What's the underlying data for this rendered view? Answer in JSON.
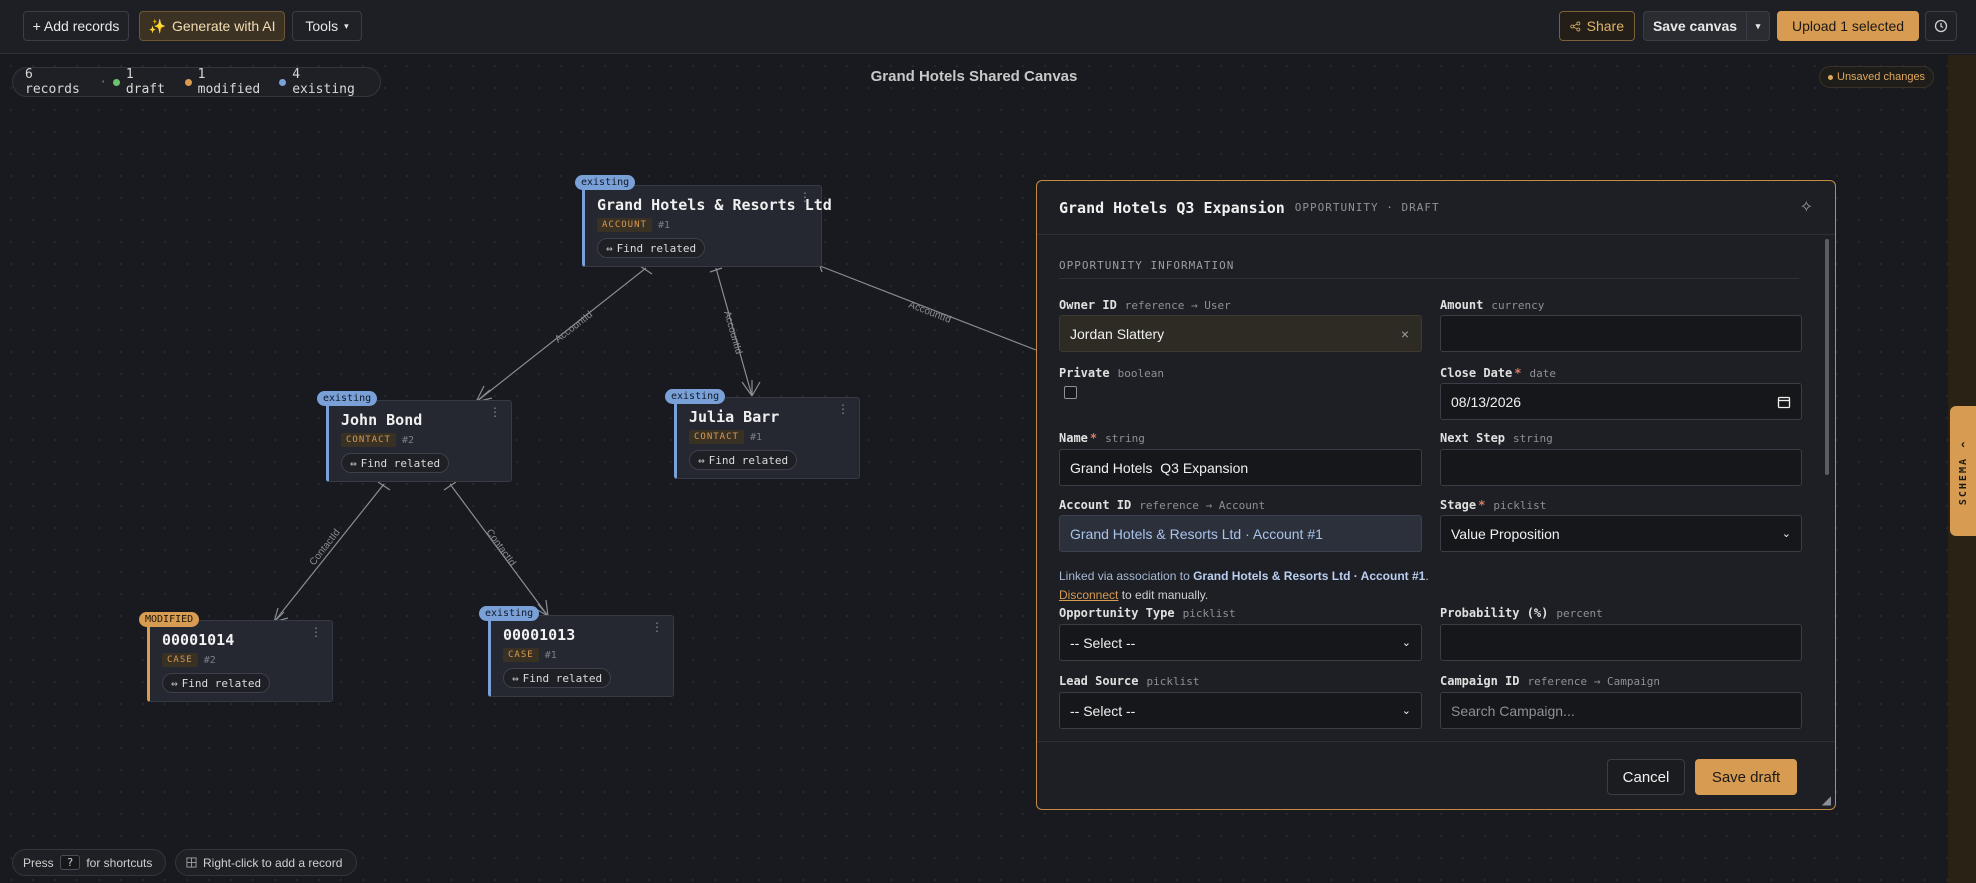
{
  "toolbar": {
    "add_records": "+ Add records",
    "generate_ai": "Generate with AI",
    "tools": "Tools",
    "share": "Share",
    "save_canvas": "Save canvas",
    "upload": "Upload 1 selected"
  },
  "status": {
    "records": "6 records",
    "draft": "1 draft",
    "modified": "1 modified",
    "existing": "4 existing",
    "colors": {
      "draft": "#6cc26c",
      "modified": "#d79b51",
      "existing": "#7aa0d8"
    }
  },
  "canvas_title": "Grand Hotels Shared Canvas",
  "unsaved": "Unsaved changes",
  "cards": {
    "account": {
      "badge": "existing",
      "title": "Grand Hotels & Resorts Ltd",
      "type": "ACCOUNT",
      "num": "#1",
      "find": "Find related"
    },
    "john": {
      "badge": "existing",
      "title": "John Bond",
      "type": "CONTACT",
      "num": "#2",
      "find": "Find related"
    },
    "julia": {
      "badge": "existing",
      "title": "Julia Barr",
      "type": "CONTACT",
      "num": "#1",
      "find": "Find related"
    },
    "case1014": {
      "badge": "MODIFIED",
      "title": "00001014",
      "type": "CASE",
      "num": "#2",
      "find": "Find related"
    },
    "case1013": {
      "badge": "existing",
      "title": "00001013",
      "type": "CASE",
      "num": "#1",
      "find": "Find related"
    }
  },
  "edges": {
    "account_john": "AccountId",
    "account_julia": "AccountId",
    "account_modal": "AccountId",
    "john_1014": "ContactId",
    "john_1013": "ContactId"
  },
  "modal": {
    "title": "Grand Hotels Q3 Expansion",
    "subtitle": "OPPORTUNITY · DRAFT",
    "section": "OPPORTUNITY INFORMATION",
    "owner": {
      "label": "Owner ID",
      "type": "reference → User",
      "value": "Jordan Slattery"
    },
    "amount": {
      "label": "Amount",
      "type": "currency",
      "value": ""
    },
    "private": {
      "label": "Private",
      "type": "boolean"
    },
    "close_date": {
      "label": "Close Date",
      "type": "date",
      "value": "08/13/2026"
    },
    "name": {
      "label": "Name",
      "type": "string",
      "value": "Grand Hotels  Q3 Expansion"
    },
    "next_step": {
      "label": "Next Step",
      "type": "string",
      "value": ""
    },
    "account": {
      "label": "Account ID",
      "type": "reference → Account",
      "value": "Grand Hotels & Resorts Ltd · Account #1"
    },
    "stage": {
      "label": "Stage",
      "type": "picklist",
      "value": "Value Proposition"
    },
    "linked": {
      "prefix": "Linked via association to",
      "target": "Grand Hotels & Resorts Ltd · Account #1",
      "disconnect": "Disconnect",
      "suffix": "to edit manually."
    },
    "opp_type": {
      "label": "Opportunity Type",
      "type": "picklist",
      "value": "-- Select --"
    },
    "probability": {
      "label": "Probability (%)",
      "type": "percent",
      "value": ""
    },
    "lead_source": {
      "label": "Lead Source",
      "type": "picklist",
      "value": "-- Select --"
    },
    "campaign": {
      "label": "Campaign ID",
      "type": "reference → Campaign",
      "placeholder": "Search Campaign..."
    },
    "cancel": "Cancel",
    "save_draft": "Save draft"
  },
  "schema_tab": "SCHEMA",
  "footer": {
    "press": "Press",
    "key": "?",
    "shortcuts": "for shortcuts",
    "right_click": "Right-click to add a record"
  }
}
